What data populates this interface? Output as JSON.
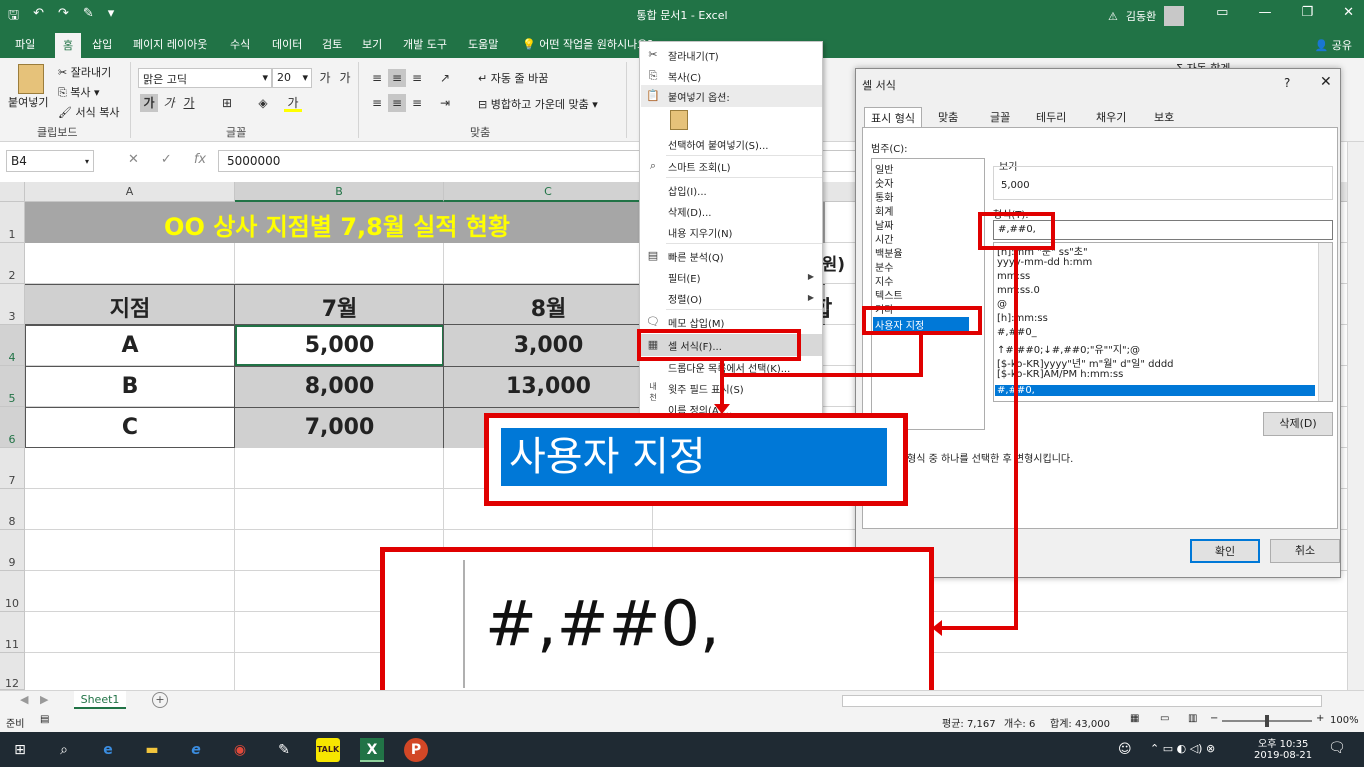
{
  "titlebar": {
    "doc_title": "통합 문서1  -  Excel",
    "user_name": "김동환",
    "qat_icons": [
      "save-icon",
      "undo-icon",
      "redo-icon",
      "paint-icon",
      "customize-icon"
    ]
  },
  "ribbon_tabs": [
    "파일",
    "홈",
    "삽입",
    "페이지 레이아웃",
    "수식",
    "데이터",
    "검토",
    "보기",
    "개발 도구",
    "도움말",
    "어떤 작업을 원하시나요?"
  ],
  "share_label": "공유",
  "clipboard": {
    "paste": "붙여넣기",
    "cut": "잘라내기",
    "copy": "복사",
    "format_painter": "서식 복사",
    "group": "클립보드"
  },
  "font": {
    "name": "맑은 고딕",
    "size": "20",
    "bold": "가",
    "italic": "가",
    "underline": "가",
    "group": "글꼴"
  },
  "alignment": {
    "wrap": "자동 줄 바꿈",
    "merge": "병합하고 가운데 맞춤",
    "group": "맞춤"
  },
  "ribbon_right": {
    "autosum": "자동 합계"
  },
  "formula_bar": {
    "name_box": "B4",
    "value": "5000000",
    "fx": "fx"
  },
  "columns": [
    "A",
    "B",
    "C"
  ],
  "rows": [
    "1",
    "2",
    "3",
    "4",
    "5",
    "6",
    "7",
    "8",
    "9",
    "10",
    "11",
    "12"
  ],
  "sheet": {
    "title": "OO 상사 지점별 7,8월 실적 현황",
    "unit_fragment": "천원)",
    "headers": [
      "지점",
      "7월",
      "8월",
      "합"
    ],
    "data": [
      [
        "A",
        "5,000",
        "3,000"
      ],
      [
        "B",
        "8,000",
        "13,000"
      ],
      [
        "C",
        "7,000",
        ""
      ]
    ]
  },
  "context_menu": {
    "items": [
      {
        "label": "잘라내기(T)",
        "icon": "cut-icon"
      },
      {
        "label": "복사(C)",
        "icon": "copy-icon"
      },
      {
        "label": "붙여넣기 옵션:",
        "icon": "paste-icon"
      },
      {
        "label": "",
        "icon": "paste-option-icon"
      },
      {
        "label": "선택하여 붙여넣기(S)...",
        "icon": ""
      },
      {
        "label": "스마트 조회(L)",
        "icon": "search-icon"
      },
      {
        "label": "삽입(I)...",
        "icon": ""
      },
      {
        "label": "삭제(D)...",
        "icon": ""
      },
      {
        "label": "내용 지우기(N)",
        "icon": ""
      },
      {
        "label": "빠른 분석(Q)",
        "icon": "quick-analysis-icon"
      },
      {
        "label": "필터(E)",
        "icon": ""
      },
      {
        "label": "정렬(O)",
        "icon": ""
      },
      {
        "label": "메모 삽입(M)",
        "icon": "comment-icon"
      },
      {
        "label": "셀 서식(F)...",
        "icon": "format-cells-icon"
      },
      {
        "label": "드롭다운 목록에서 선택(K)...",
        "icon": ""
      },
      {
        "label": "윗주 필드 표시(S)",
        "icon": "phonetic-icon"
      },
      {
        "label": "이름 정의(A)...",
        "icon": ""
      }
    ]
  },
  "dialog": {
    "title": "셀 서식",
    "help": "?",
    "close": "✕",
    "tabs": [
      "표시 형식",
      "맞춤",
      "글꼴",
      "테두리",
      "채우기",
      "보호"
    ],
    "category_label": "범주(C):",
    "categories": [
      "일반",
      "숫자",
      "통화",
      "회계",
      "날짜",
      "시간",
      "백분율",
      "분수",
      "지수",
      "텍스트",
      "기타",
      "사용자 지정"
    ],
    "sample_label": "보기",
    "sample_value": "5,000",
    "type_label": "형식(T):",
    "type_value": "#,##0,",
    "format_list": [
      "[h]:mm \"분\" ss\"초\"",
      "yyyy-mm-dd h:mm",
      "mm:ss",
      "mm:ss.0",
      "@",
      "[h]:mm:ss",
      "#,##0_",
      "↑#,##0;↓#,##0;\"유\"\"지\";@",
      "[$-ko-KR]yyyy\"년\" m\"월\" d\"일\" dddd",
      "[$-ko-KR]AM/PM h:mm:ss",
      "#,##0,"
    ],
    "delete_button": "삭제(D)",
    "description": "형식 중 하나를 선택한 후 변형시킵니다.",
    "ok": "확인",
    "cancel": "취소"
  },
  "callouts": {
    "zoom_category": "사용자 지정",
    "zoom_format": "#,##0,"
  },
  "sheet_tab": "Sheet1",
  "status": {
    "ready": "준비",
    "average": "평균: 7,167",
    "count": "개수: 6",
    "sum": "합계: 43,000",
    "zoom": "100%"
  },
  "taskbar": {
    "time": "오후 10:35",
    "date": "2019-08-21",
    "apps": [
      "windows-start-icon",
      "search-icon",
      "edge-icon",
      "file-explorer-icon",
      "ie-icon",
      "chrome-icon",
      "paint-icon",
      "kakaotalk-icon",
      "excel-icon",
      "powerpoint-icon"
    ]
  },
  "colors": {
    "excel_green": "#217346",
    "callout_red": "#e00000",
    "selection_blue": "#0078d7",
    "title_yellow": "#ffff00"
  }
}
